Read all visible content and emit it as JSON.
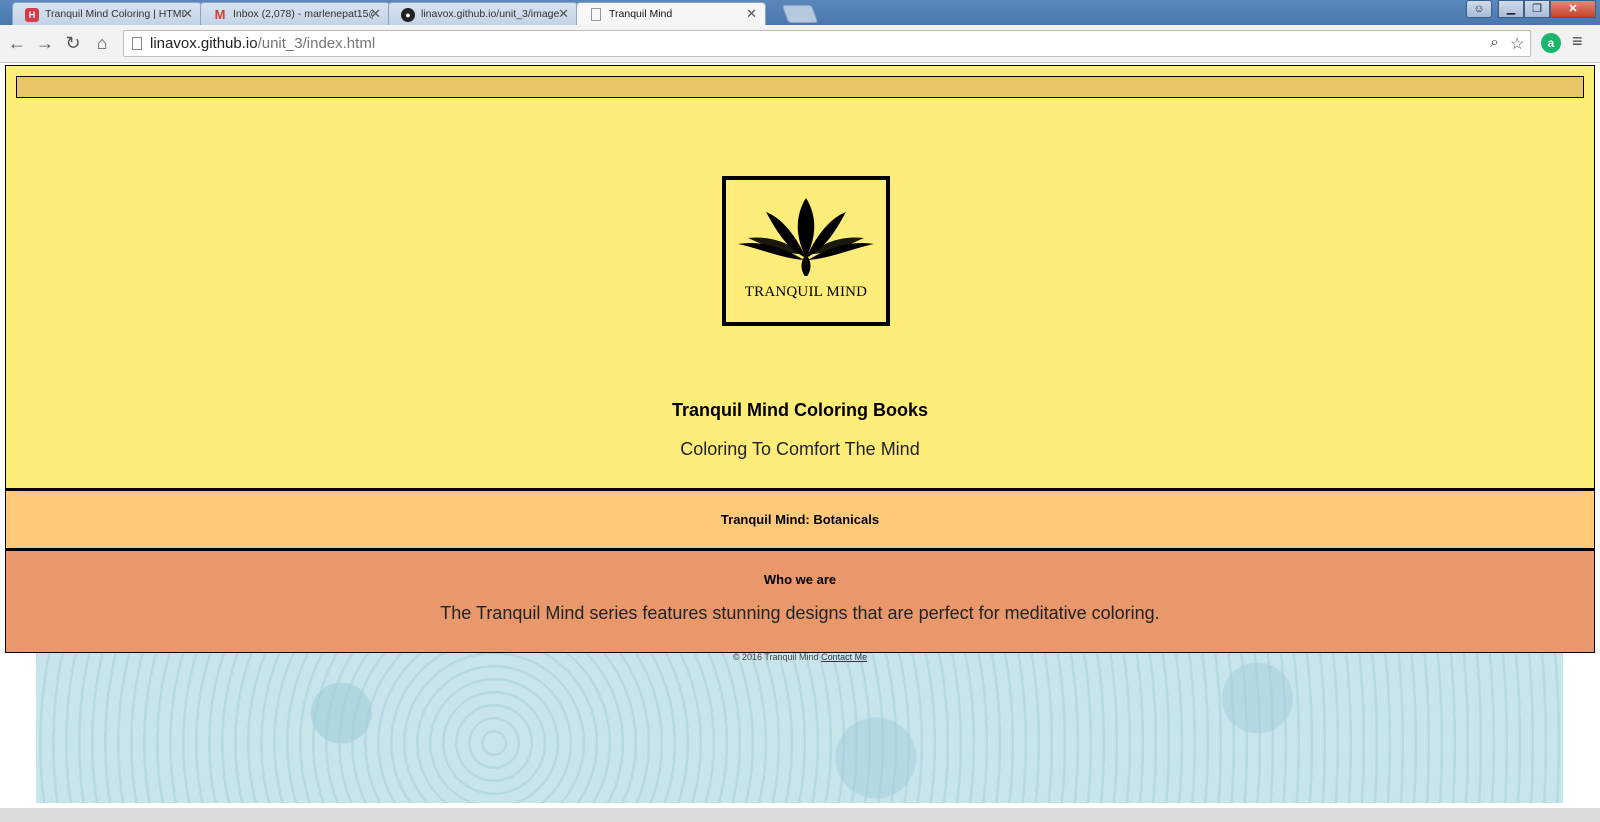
{
  "browser": {
    "tabs": [
      {
        "label": "Tranquil Mind Coloring | HTML",
        "icon": "html-favicon-icon",
        "active": false
      },
      {
        "label": "Inbox (2,078) - marlenepat15@",
        "icon": "gmail-icon",
        "active": false
      },
      {
        "label": "linavox.github.io/unit_3/image",
        "icon": "github-icon",
        "active": false
      },
      {
        "label": "Tranquil Mind",
        "icon": "page-icon",
        "active": true
      }
    ],
    "url_host": "linavox.github.io",
    "url_path": "/unit_3/index.html",
    "colors": {
      "tab_strip": "#4a78ad",
      "toolbar": "#f2f2f2"
    }
  },
  "header": {
    "logo_text": "TRANQUIL MIND",
    "title": "Tranquil Mind Coloring Books",
    "subtitle": "Coloring To Comfort The Mind"
  },
  "books": {
    "title": "Tranquil Mind: Botanicals"
  },
  "about": {
    "title": "Who we are",
    "text": "The Tranquil Mind series features stunning designs that are perfect for meditative coloring."
  },
  "footer": {
    "copyright": "© 2016 Tranquil Mind",
    "contact_link": "Contact Me"
  },
  "colors": {
    "header_bg": "#ffed7a",
    "nav_bar_bg": "#e8c668",
    "books_bg": "#ffc97a",
    "about_bg": "#e8986a",
    "pattern_bg": "#c8e5ec"
  }
}
